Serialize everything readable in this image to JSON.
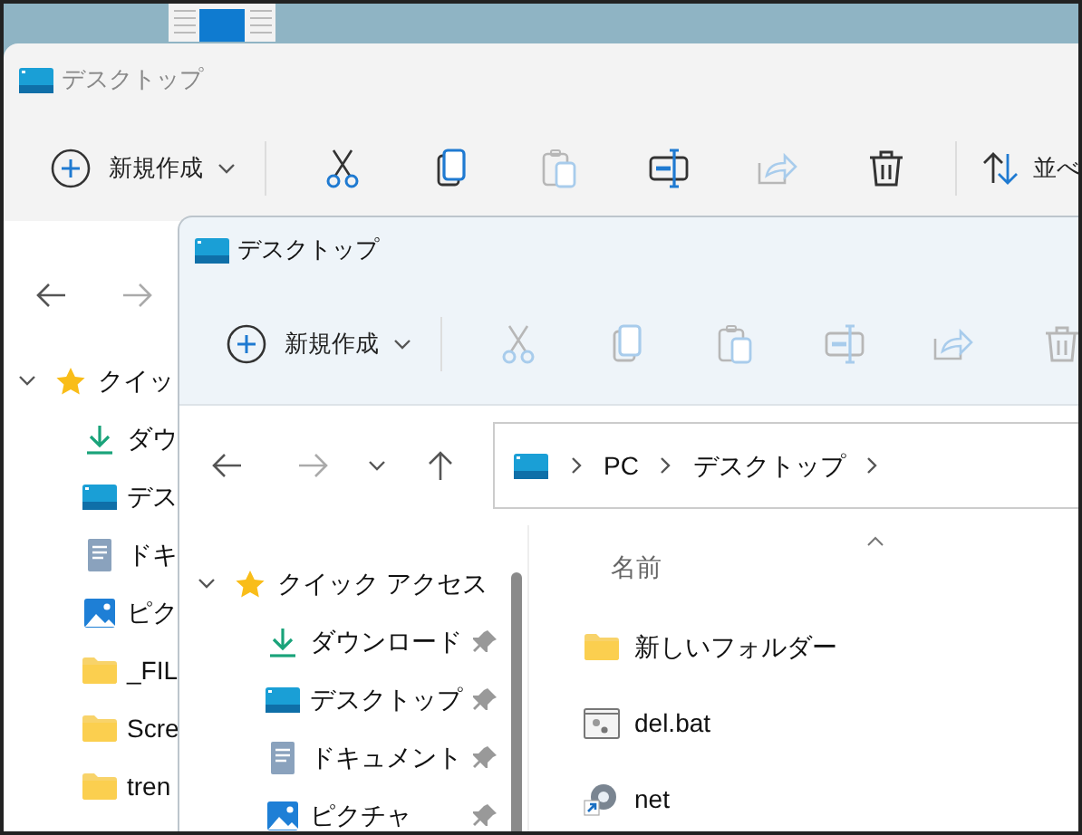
{
  "back_window": {
    "title": "デスクトップ",
    "active": false,
    "toolbar": {
      "new_label": "新規作成",
      "items": [
        {
          "kind": "cut",
          "disabled": false
        },
        {
          "kind": "copy",
          "disabled": false
        },
        {
          "kind": "paste",
          "disabled": true
        },
        {
          "kind": "rename",
          "disabled": false
        },
        {
          "kind": "share",
          "disabled": true
        },
        {
          "kind": "delete",
          "disabled": false
        }
      ],
      "sort_label": "並べ"
    },
    "nav": {
      "forward_disabled": true
    },
    "tree": [
      {
        "label": "クイッ",
        "kind": "quick",
        "expanded": true,
        "children": [
          {
            "label": "ダウ",
            "kind": "download"
          },
          {
            "label": "デス",
            "kind": "desktop"
          },
          {
            "label": "ドキ",
            "kind": "document"
          },
          {
            "label": "ピク",
            "kind": "picture"
          },
          {
            "label": "_FIL",
            "kind": "folder"
          },
          {
            "label": "Scre",
            "kind": "folder"
          },
          {
            "label": "tren",
            "kind": "folder"
          }
        ]
      }
    ]
  },
  "front_window": {
    "title": "デスクトップ",
    "active": true,
    "toolbar": {
      "new_label": "新規作成",
      "items": [
        {
          "kind": "cut",
          "disabled": true
        },
        {
          "kind": "copy",
          "disabled": true
        },
        {
          "kind": "paste",
          "disabled": true
        },
        {
          "kind": "rename",
          "disabled": true
        },
        {
          "kind": "share",
          "disabled": true
        },
        {
          "kind": "delete",
          "disabled": true
        }
      ]
    },
    "nav": {
      "forward_disabled": true
    },
    "address": [
      "PC",
      "デスクトップ"
    ],
    "tree": [
      {
        "label": "クイック アクセス",
        "kind": "quick",
        "expanded": true,
        "children": [
          {
            "label": "ダウンロード",
            "kind": "download",
            "pinned": true
          },
          {
            "label": "デスクトップ",
            "kind": "desktop",
            "pinned": true
          },
          {
            "label": "ドキュメント",
            "kind": "document",
            "pinned": true
          },
          {
            "label": "ピクチャ",
            "kind": "picture",
            "pinned": true
          }
        ]
      }
    ],
    "column": {
      "label": "名前",
      "sort_ascending": true
    },
    "files": [
      {
        "name": "新しいフォルダー",
        "kind": "folder"
      },
      {
        "name": "del.bat",
        "kind": "bat"
      },
      {
        "name": "net",
        "kind": "shortcut"
      }
    ]
  }
}
